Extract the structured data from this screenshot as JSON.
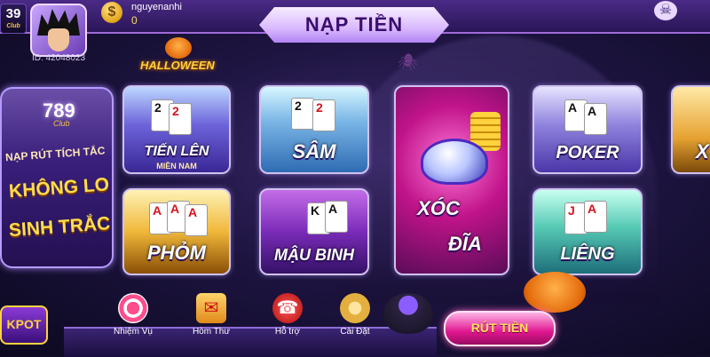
{
  "header": {
    "club_badge": "39",
    "club_sub": "Club",
    "username": "nguyenanhi",
    "balance": "0",
    "user_id": "ID: 42048023",
    "coin_symbol": "$",
    "deposit_title": "NẠP TIỀN",
    "skull_symbol": "☠"
  },
  "event": {
    "label": "HALLOWEEN"
  },
  "promo": {
    "logo": "789",
    "club": "Club",
    "line1": "NẠP RÚT TÍCH TẮC",
    "line2": "KHÔNG LO",
    "line3": "SINH TRẮC"
  },
  "games": {
    "tienlen": {
      "label": "TIẾN LÊN",
      "sub": "MIỀN NAM"
    },
    "sam": {
      "label": "SÂM"
    },
    "xocdia": {
      "label1": "XÓC",
      "label2": "ĐĨA"
    },
    "poker": {
      "label": "POKER"
    },
    "partial": {
      "label": "X"
    },
    "phom": {
      "label": "PHỎM"
    },
    "maubinh": {
      "label": "MẬU BINH"
    },
    "lieng": {
      "label": "LIÊNG"
    }
  },
  "nav": {
    "missions": "Nhiệm Vụ",
    "mail": "Hòm Thư",
    "support": "Hỗ trợ",
    "settings": "Cài Đặt"
  },
  "withdraw": {
    "label": "RÚT TIỀN"
  },
  "jackpot": {
    "label": "KPOT"
  },
  "colors": {
    "accent": "#a06ad8",
    "gold": "#ffdd4a",
    "pink": "#e0168f"
  }
}
